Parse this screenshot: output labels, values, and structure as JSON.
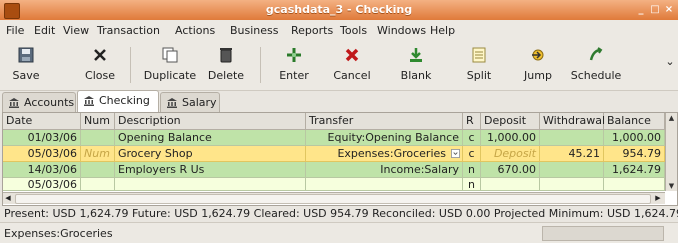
{
  "window": {
    "title": "gcashdata_3 - Checking",
    "controls": [
      "_",
      "□",
      "×"
    ]
  },
  "menu": [
    "File",
    "Edit",
    "View",
    "Transaction",
    "Actions",
    "Business",
    "Reports",
    "Tools",
    "Windows",
    "Help"
  ],
  "toolbar": {
    "save": "Save",
    "close": "Close",
    "duplicate": "Duplicate",
    "delete": "Delete",
    "enter": "Enter",
    "cancel": "Cancel",
    "blank": "Blank",
    "split": "Split",
    "jump": "Jump",
    "schedule": "Schedule",
    "more": "⌄"
  },
  "tabs": [
    "Accounts",
    "Checking",
    "Salary"
  ],
  "register": {
    "headers": {
      "date": "Date",
      "num": "Num",
      "description": "Description",
      "transfer": "Transfer",
      "r": "R",
      "deposit": "Deposit",
      "withdrawal": "Withdrawal",
      "balance": "Balance"
    },
    "rows": [
      {
        "date": "01/03/06",
        "num": "",
        "description": "Opening Balance",
        "transfer": "Equity:Opening Balance",
        "r": "c",
        "deposit": "1,000.00",
        "withdrawal": "",
        "balance": "1,000.00"
      },
      {
        "date": "05/03/06",
        "num": "Num",
        "description": "Grocery Shop",
        "transfer": "Expenses:Groceries",
        "r": "c",
        "deposit": "Deposit",
        "withdrawal": "45.21",
        "balance": "954.79"
      },
      {
        "date": "14/03/06",
        "num": "",
        "description": "Employers R Us",
        "transfer": "Income:Salary",
        "r": "n",
        "deposit": "670.00",
        "withdrawal": "",
        "balance": "1,624.79"
      },
      {
        "date": "05/03/06",
        "num": "",
        "description": "",
        "transfer": "",
        "r": "n",
        "deposit": "",
        "withdrawal": "",
        "balance": ""
      }
    ]
  },
  "summary": "Present: USD 1,624.79   Future: USD 1,624.79   Cleared: USD 954.79   Reconciled: USD 0.00   Projected Minimum: USD 1,624.79",
  "status": "Expenses:Groceries"
}
